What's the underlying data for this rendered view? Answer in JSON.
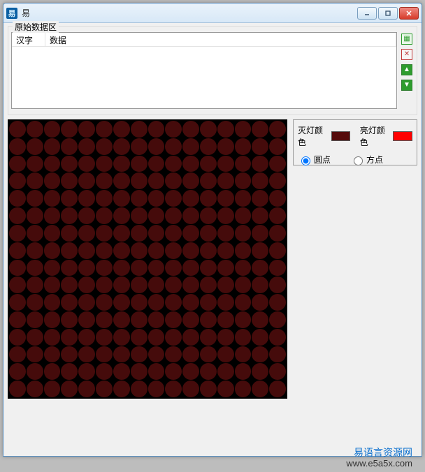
{
  "window": {
    "title": "易",
    "icon_letter": "易"
  },
  "group": {
    "title": "原始数据区",
    "columns": {
      "hanzi": "汉字",
      "data": "数据"
    }
  },
  "controls": {
    "off_label": "灭灯颜色",
    "on_label": "亮灯颜色",
    "off_color": "#560c0c",
    "on_color": "#ff0000",
    "shape_circle": "圆点",
    "shape_square": "方点",
    "shape_selected": "circle"
  },
  "matrix": {
    "rows": 16,
    "cols": 16,
    "shape": "circle",
    "all_off": true
  },
  "footer": {
    "brand": "易语言资源网",
    "url": "www.e5a5x.com"
  }
}
